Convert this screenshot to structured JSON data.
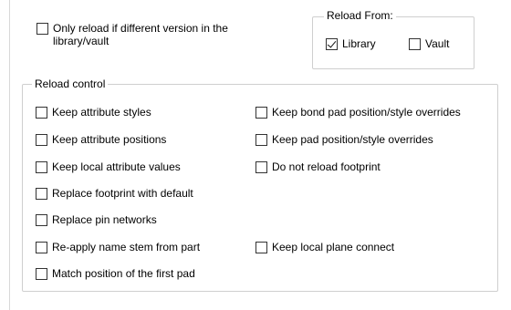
{
  "only_reload": {
    "label": "Only reload if different version in the library/vault",
    "checked": false
  },
  "reload_from": {
    "title": "Reload From:",
    "library": {
      "label": "Library",
      "checked": true
    },
    "vault": {
      "label": "Vault",
      "checked": false
    }
  },
  "reload_control": {
    "title": "Reload control",
    "items": [
      {
        "label": "Keep attribute styles",
        "checked": false
      },
      {
        "label": "Keep bond pad position/style overrides",
        "checked": false
      },
      {
        "label": "Keep attribute positions",
        "checked": false
      },
      {
        "label": "Keep pad position/style overrides",
        "checked": false
      },
      {
        "label": "Keep local attribute values",
        "checked": false
      },
      {
        "label": "Do not reload footprint",
        "checked": false
      },
      {
        "label": "Replace footprint with default",
        "checked": false
      },
      {
        "label": "Replace pin networks",
        "checked": false
      },
      {
        "label": "Re-apply name stem from part",
        "checked": false
      },
      {
        "label": "Keep local plane connect",
        "checked": false
      },
      {
        "label": "Match position of the first pad",
        "checked": false
      }
    ]
  }
}
